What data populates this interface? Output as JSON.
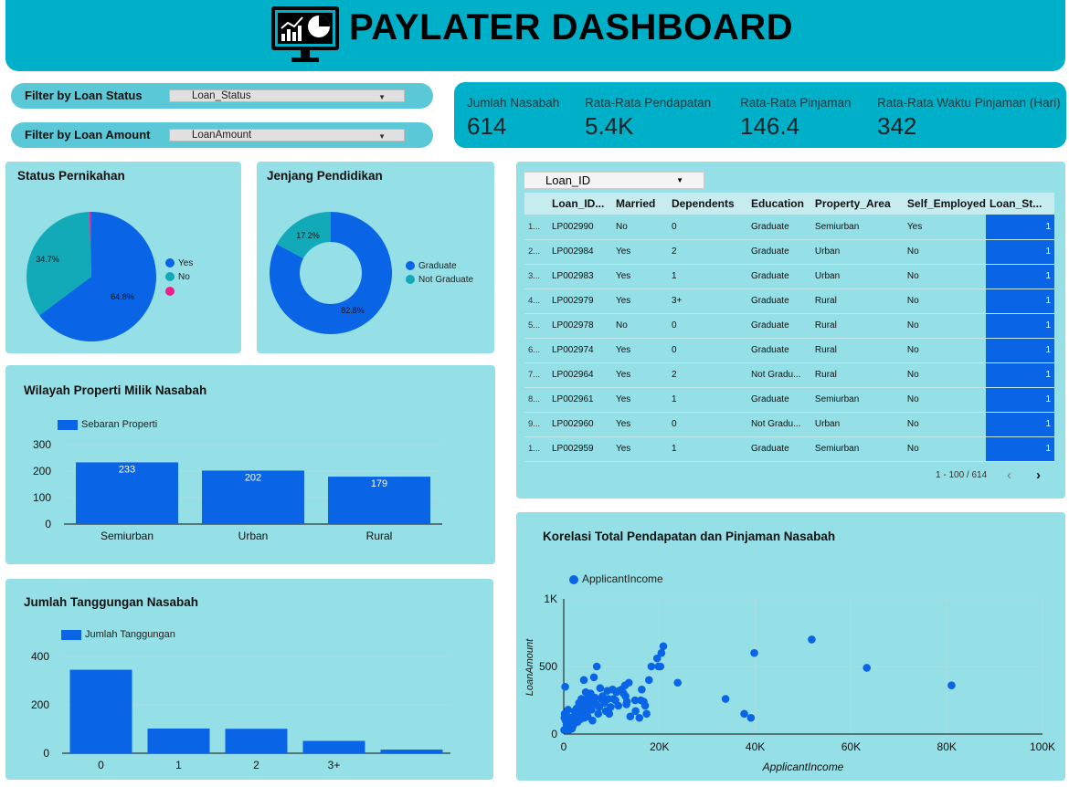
{
  "header": {
    "title": "PAYLATER DASHBOARD",
    "logo_icon": "dashboard-monitor-icon"
  },
  "filters": [
    {
      "label": "Filter by Loan Status",
      "value": "Loan_Status"
    },
    {
      "label": "Filter by Loan Amount",
      "value": "LoanAmount"
    }
  ],
  "kpis": [
    {
      "label": "Jumlah Nasabah",
      "value": "614"
    },
    {
      "label": "Rata-Rata Pendapatan",
      "value": "5.4K"
    },
    {
      "label": "Rata-Rata Pinjaman",
      "value": "146.4"
    },
    {
      "label": "Rata-Rata Waktu Pinjaman (Hari)",
      "value": "342"
    }
  ],
  "table": {
    "selector": "Loan_ID",
    "columns": [
      "Loan_ID...",
      "Married",
      "Dependents",
      "Education",
      "Property_Area",
      "Self_Employed",
      "Loan_St..."
    ],
    "rows": [
      {
        "idx": "1...",
        "cells": [
          "LP002990",
          "No",
          "0",
          "Graduate",
          "Semiurban",
          "Yes",
          "1"
        ]
      },
      {
        "idx": "2...",
        "cells": [
          "LP002984",
          "Yes",
          "2",
          "Graduate",
          "Urban",
          "No",
          "1"
        ]
      },
      {
        "idx": "3...",
        "cells": [
          "LP002983",
          "Yes",
          "1",
          "Graduate",
          "Urban",
          "No",
          "1"
        ]
      },
      {
        "idx": "4...",
        "cells": [
          "LP002979",
          "Yes",
          "3+",
          "Graduate",
          "Rural",
          "No",
          "1"
        ]
      },
      {
        "idx": "5...",
        "cells": [
          "LP002978",
          "No",
          "0",
          "Graduate",
          "Rural",
          "No",
          "1"
        ]
      },
      {
        "idx": "6...",
        "cells": [
          "LP002974",
          "Yes",
          "0",
          "Graduate",
          "Rural",
          "No",
          "1"
        ]
      },
      {
        "idx": "7...",
        "cells": [
          "LP002964",
          "Yes",
          "2",
          "Not Gradu...",
          "Rural",
          "No",
          "1"
        ]
      },
      {
        "idx": "8...",
        "cells": [
          "LP002961",
          "Yes",
          "1",
          "Graduate",
          "Semiurban",
          "No",
          "1"
        ]
      },
      {
        "idx": "9...",
        "cells": [
          "LP002960",
          "Yes",
          "0",
          "Not Gradu...",
          "Urban",
          "No",
          "1"
        ]
      },
      {
        "idx": "1...",
        "cells": [
          "LP002959",
          "Yes",
          "1",
          "Graduate",
          "Semiurban",
          "No",
          "1"
        ]
      }
    ],
    "pagination": "1 - 100 / 614"
  },
  "chart_data": [
    {
      "id": "marital",
      "type": "pie",
      "title": "Status Pernikahan",
      "categories": [
        "Yes",
        "No",
        ""
      ],
      "values": [
        64.8,
        34.7,
        0.5
      ],
      "labels": [
        "64.8%",
        "34.7%",
        ""
      ],
      "colors": [
        "#0a64e6",
        "#12a9b8",
        "#ec1f8b"
      ]
    },
    {
      "id": "education",
      "type": "pie",
      "title": "Jenjang Pendidikan",
      "categories": [
        "Graduate",
        "Not Graduate"
      ],
      "values": [
        82.8,
        17.2
      ],
      "labels": [
        "82.8%",
        "17.2%"
      ],
      "colors": [
        "#0a64e6",
        "#12a9b8"
      ]
    },
    {
      "id": "property",
      "type": "bar",
      "title": "Wilayah Properti Milik Nasabah",
      "series": [
        {
          "name": "Sebaran Properti",
          "values": [
            233,
            202,
            179
          ]
        }
      ],
      "categories": [
        "Semiurban",
        "Urban",
        "Rural"
      ],
      "data_labels": [
        "233",
        "202",
        "179"
      ],
      "yticks": [
        "0",
        "100",
        "200",
        "300"
      ],
      "ylim": [
        0,
        300
      ],
      "color": "#0a64e6"
    },
    {
      "id": "dependents",
      "type": "bar",
      "title": "Jumlah Tanggungan Nasabah",
      "series": [
        {
          "name": "Jumlah Tanggungan",
          "values": [
            345,
            102,
            101,
            51,
            15
          ]
        }
      ],
      "categories": [
        "0",
        "1",
        "2",
        "3+",
        ""
      ],
      "yticks": [
        "0",
        "200",
        "400"
      ],
      "ylim": [
        0,
        400
      ],
      "color": "#0a64e6"
    },
    {
      "id": "scatter",
      "type": "scatter",
      "title": "Korelasi Total Pendapatan dan Pinjaman Nasabah",
      "xlabel": "ApplicantIncome",
      "ylabel": "LoanAmount",
      "series": [
        {
          "name": "ApplicantIncome"
        }
      ],
      "xlim": [
        0,
        100000
      ],
      "ylim": [
        0,
        1000
      ],
      "xticks": [
        "0",
        "20K",
        "40K",
        "60K",
        "80K",
        "100K"
      ],
      "yticks": [
        "0",
        "500",
        "1K"
      ],
      "color": "#0a64e6",
      "points": [
        [
          81000,
          360
        ],
        [
          63300,
          490
        ],
        [
          51800,
          700
        ],
        [
          39800,
          600
        ],
        [
          39100,
          120
        ],
        [
          37700,
          150
        ],
        [
          33800,
          260
        ],
        [
          23800,
          380
        ],
        [
          20800,
          650
        ],
        [
          20400,
          600
        ],
        [
          20200,
          500
        ],
        [
          19800,
          500
        ],
        [
          19500,
          560
        ],
        [
          18300,
          500
        ],
        [
          17800,
          400
        ],
        [
          17300,
          150
        ],
        [
          17000,
          210
        ],
        [
          16700,
          240
        ],
        [
          16300,
          330
        ],
        [
          16100,
          250
        ],
        [
          15800,
          120
        ],
        [
          15000,
          170
        ],
        [
          14900,
          250
        ],
        [
          13900,
          130
        ],
        [
          13600,
          380
        ],
        [
          13200,
          240
        ],
        [
          13100,
          220
        ],
        [
          12900,
          280
        ],
        [
          12800,
          360
        ],
        [
          12500,
          300
        ],
        [
          12100,
          330
        ],
        [
          11500,
          320
        ],
        [
          11400,
          210
        ],
        [
          11000,
          310
        ],
        [
          10800,
          250
        ],
        [
          10400,
          260
        ],
        [
          10200,
          330
        ],
        [
          9800,
          200
        ],
        [
          9500,
          150
        ],
        [
          9300,
          260
        ],
        [
          9100,
          320
        ],
        [
          8800,
          170
        ],
        [
          8500,
          230
        ],
        [
          8100,
          280
        ],
        [
          7900,
          260
        ],
        [
          7600,
          340
        ],
        [
          7400,
          200
        ],
        [
          7200,
          150
        ],
        [
          6900,
          500
        ],
        [
          6800,
          220
        ],
        [
          6500,
          270
        ],
        [
          6300,
          420
        ],
        [
          6100,
          250
        ],
        [
          6000,
          100
        ],
        [
          5800,
          180
        ],
        [
          5600,
          300
        ],
        [
          5500,
          230
        ],
        [
          5300,
          190
        ],
        [
          5100,
          210
        ],
        [
          5000,
          130
        ],
        [
          4900,
          260
        ],
        [
          4800,
          200
        ],
        [
          4700,
          160
        ],
        [
          4600,
          310
        ],
        [
          4500,
          240
        ],
        [
          4400,
          180
        ],
        [
          4300,
          120
        ],
        [
          4200,
          400
        ],
        [
          4100,
          220
        ],
        [
          4000,
          170
        ],
        [
          3900,
          140
        ],
        [
          3800,
          200
        ],
        [
          3700,
          260
        ],
        [
          3600,
          150
        ],
        [
          3500,
          110
        ],
        [
          3400,
          180
        ],
        [
          3300,
          130
        ],
        [
          3200,
          230
        ],
        [
          3100,
          160
        ],
        [
          3000,
          120
        ],
        [
          2900,
          90
        ],
        [
          2800,
          140
        ],
        [
          2700,
          190
        ],
        [
          2600,
          110
        ],
        [
          2500,
          150
        ],
        [
          2400,
          100
        ],
        [
          2300,
          170
        ],
        [
          2200,
          80
        ],
        [
          2100,
          130
        ],
        [
          2000,
          110
        ],
        [
          1900,
          60
        ],
        [
          1800,
          90
        ],
        [
          1700,
          40
        ],
        [
          1500,
          120
        ],
        [
          1300,
          70
        ],
        [
          1100,
          30
        ],
        [
          1000,
          90
        ],
        [
          900,
          180
        ],
        [
          800,
          130
        ],
        [
          600,
          70
        ],
        [
          400,
          100
        ],
        [
          300,
          350
        ],
        [
          200,
          150
        ],
        [
          150,
          120
        ],
        [
          100,
          30
        ]
      ]
    }
  ]
}
